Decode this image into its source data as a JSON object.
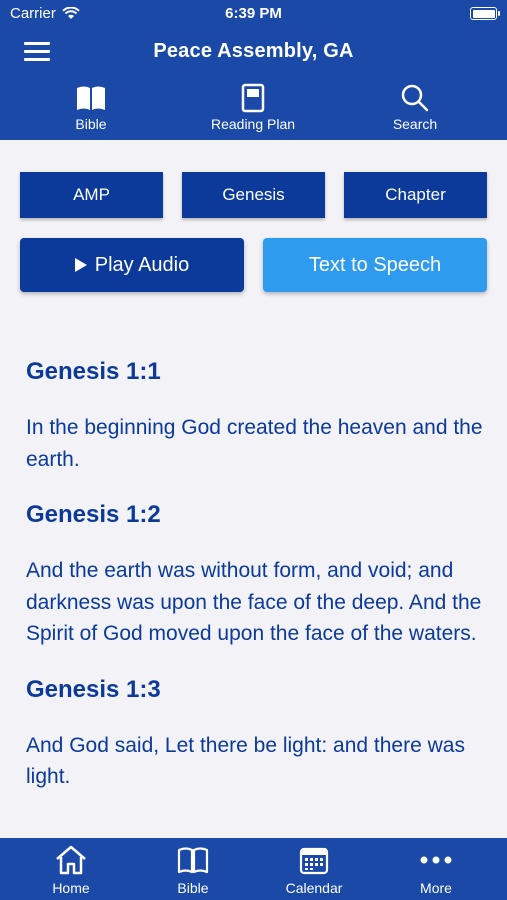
{
  "status_bar": {
    "carrier": "Carrier",
    "time": "6:39 PM"
  },
  "header": {
    "title": "Peace Assembly, GA"
  },
  "top_nav": [
    {
      "label": "Bible",
      "icon": "open-book-icon"
    },
    {
      "label": "Reading Plan",
      "icon": "notebook-icon"
    },
    {
      "label": "Search",
      "icon": "search-icon"
    }
  ],
  "selectors": {
    "version": "AMP",
    "book": "Genesis",
    "chapter": "Chapter"
  },
  "actions": {
    "play_audio": "Play Audio",
    "text_to_speech": "Text to Speech"
  },
  "verses": [
    {
      "ref": "Genesis 1:1",
      "text": "In the beginning God created the heaven and the earth."
    },
    {
      "ref": "Genesis 1:2",
      "text": "And the earth was without form, and void; and darkness was upon the face of the deep. And the Spirit of God moved upon the face of the waters."
    },
    {
      "ref": "Genesis 1:3",
      "text": "And God said, Let there be light: and there was light."
    }
  ],
  "tab_bar": [
    {
      "label": "Home",
      "icon": "home-icon"
    },
    {
      "label": "Bible",
      "icon": "book-icon"
    },
    {
      "label": "Calendar",
      "icon": "calendar-icon"
    },
    {
      "label": "More",
      "icon": "more-icon"
    }
  ],
  "colors": {
    "brand": "#1a49a8",
    "button": "#0b3a9a",
    "accent": "#2f9bef",
    "text": "#0b3a9a"
  }
}
